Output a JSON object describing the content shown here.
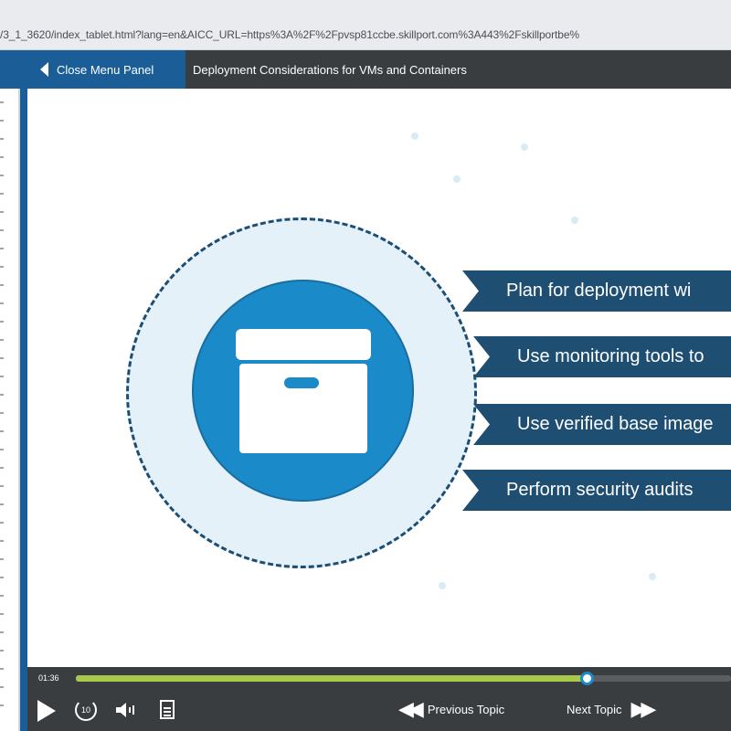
{
  "browser": {
    "url": "/3_1_3620/index_tablet.html?lang=en&AICC_URL=https%3A%2F%2Fpvsp81ccbe.skillport.com%3A443%2Fskillportbe%"
  },
  "menu_bar": {
    "close_menu_label": "Close Menu Panel",
    "module_title": "Deployment Considerations for VMs and Containers"
  },
  "slide": {
    "banners": [
      "Plan for deployment wi",
      "Use monitoring tools to",
      "Use verified base image",
      "Perform security audits"
    ],
    "colors": {
      "banner": "#1f4e73",
      "circle_fill": "#1b8ac8",
      "outer_circle": "#e4f1f8"
    },
    "icon": "archive-box-icon"
  },
  "player": {
    "time": "01:36",
    "progress": 0.78,
    "replay_seconds": "10",
    "previous_topic": "Previous Topic",
    "next_topic": "Next Topic"
  }
}
